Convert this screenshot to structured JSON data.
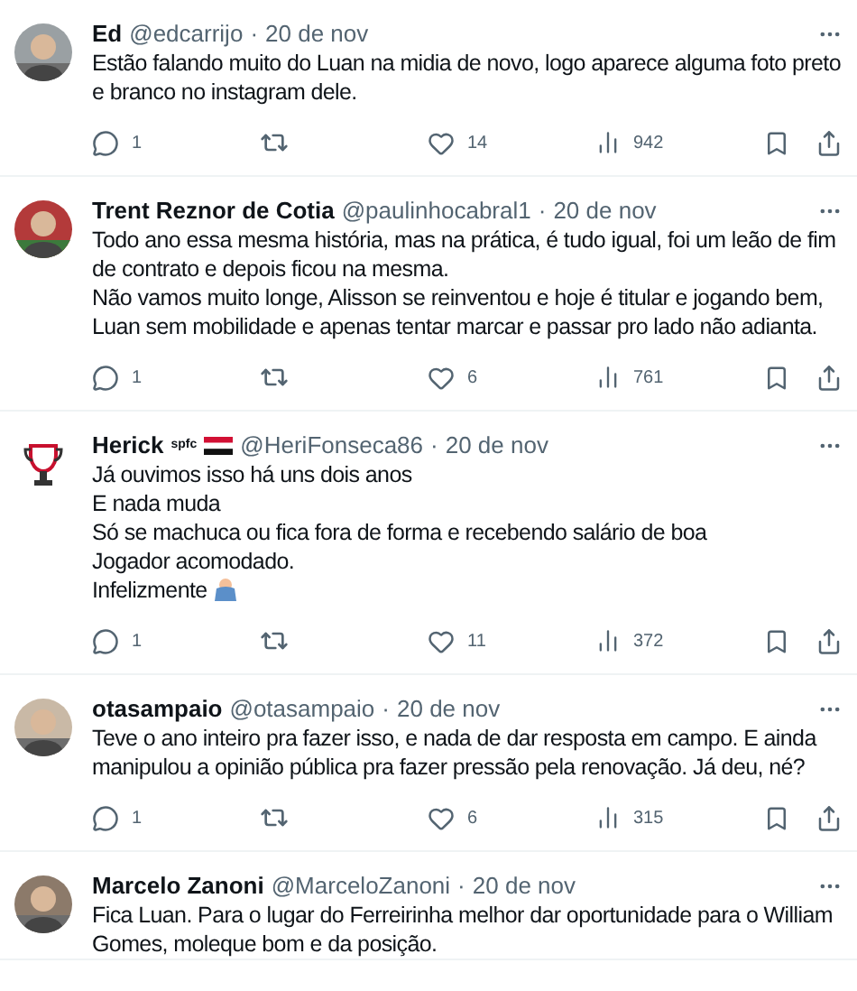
{
  "tweets": [
    {
      "avatar": {
        "kind": "picture"
      },
      "name": "Ed",
      "handle": "@edcarrijo",
      "separator": "·",
      "date": "20 de nov",
      "paragraphs": [
        "Estão falando muito do Luan na midia de novo, logo aparece alguma foto preto e branco no instagram dele."
      ],
      "actions": {
        "replies": "1",
        "likes": "14",
        "views": "942"
      }
    },
    {
      "avatar": {
        "kind": "picture"
      },
      "name": "Trent Reznor de Cotia",
      "handle": "@paulinhocabral1",
      "separator": "·",
      "date": "20 de nov",
      "paragraphs": [
        "Todo ano essa mesma história, mas na prática, é tudo igual, foi um leão de fim de contrato e depois ficou na mesma.",
        "Não vamos muito longe, Alisson se reinventou e hoje é titular e jogando bem, Luan sem mobilidade e apenas tentar marcar e passar pro lado não adianta."
      ],
      "actions": {
        "replies": "1",
        "likes": "6",
        "views": "761"
      }
    },
    {
      "avatar": {
        "kind": "logo"
      },
      "name": "Herick",
      "name_tag": "spfc",
      "flag": true,
      "handle": "@HeriFonseca86",
      "separator": "·",
      "date": "20 de nov",
      "paragraphs": [
        "Já ouvimos isso há uns dois anos",
        "E nada muda",
        "Só se machuca ou fica fora de forma e recebendo salário de boa",
        "Jogador acomodado.",
        "Infelizmente"
      ],
      "shrug_emoji": true,
      "actions": {
        "replies": "1",
        "likes": "11",
        "views": "372"
      }
    },
    {
      "avatar": {
        "kind": "picture"
      },
      "name": "otasampaio",
      "handle": "@otasampaio",
      "separator": "·",
      "date": "20 de nov",
      "paragraphs": [
        "Teve o ano inteiro pra fazer isso, e nada de dar resposta em campo. E ainda manipulou a opinião pública pra fazer pressão pela renovação. Já deu, né?"
      ],
      "actions": {
        "replies": "1",
        "likes": "6",
        "views": "315"
      }
    },
    {
      "avatar": {
        "kind": "picture"
      },
      "name": "Marcelo Zanoni",
      "handle": "@MarceloZanoni",
      "separator": "·",
      "date": "20 de nov",
      "paragraphs": [
        "Fica Luan. Para o lugar do Ferreirinha melhor dar oportunidade para o William Gomes, moleque bom e da posição."
      ]
    }
  ]
}
